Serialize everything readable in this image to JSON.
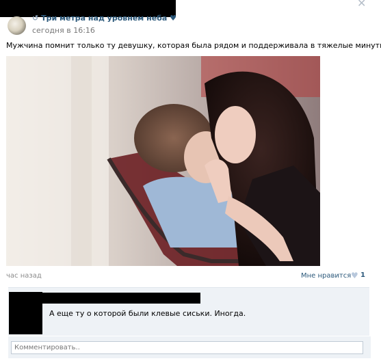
{
  "header": {
    "group_name": "Три метра над уровнем неба",
    "timestamp": "сегодня в 16:16",
    "close_symbol": "✕"
  },
  "post": {
    "text": "Мужчина помнит только ту девушку, которая была рядом и поддерживала в тяжелые минуты.",
    "photo_icon": "photo-image",
    "time_ago": "час назад",
    "like_label": "Мне нравится",
    "like_count": "1",
    "heart_symbol": "♥"
  },
  "comment": {
    "text": "А еще ту о которой были клевые сиськи. Иногда."
  },
  "comment_input": {
    "placeholder": "Комментировать.."
  },
  "colors": {
    "link": "#2b587a",
    "muted": "#777777",
    "panel": "#eef2f6"
  }
}
